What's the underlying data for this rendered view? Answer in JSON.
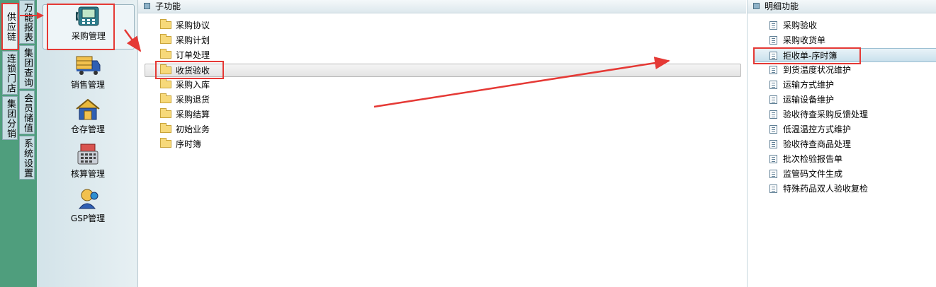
{
  "vertical_tabs": [
    "供应链",
    "连锁门店",
    "集团分销",
    "万能报表",
    "集团查询",
    "会员储值",
    "系统设置"
  ],
  "modules": [
    {
      "label": "采购管理",
      "icon": "purchase-phone-icon"
    },
    {
      "label": "销售管理",
      "icon": "delivery-truck-icon"
    },
    {
      "label": "仓存管理",
      "icon": "warehouse-house-icon"
    },
    {
      "label": "核算管理",
      "icon": "calculator-icon"
    },
    {
      "label": "GSP管理",
      "icon": "gsp-person-icon"
    }
  ],
  "sub_panel": {
    "title": "子功能",
    "items": [
      "采购协议",
      "采购计划",
      "订单处理",
      "收货验收",
      "采购入库",
      "采购退货",
      "采购结算",
      "初始业务",
      "序时簿"
    ],
    "selected": "收货验收"
  },
  "detail_panel": {
    "title": "明细功能",
    "items": [
      "采购验收",
      "采购收货单",
      "拒收单-序时簿",
      "到货温度状况维护",
      "运输方式维护",
      "运输设备维护",
      "验收待查采购反馈处理",
      "低温温控方式维护",
      "验收待查商品处理",
      "批次检验报告单",
      "监管码文件生成",
      "特殊药品双人验收复检"
    ],
    "selected": "拒收单-序时簿"
  },
  "colors": {
    "annotation": "#e53935",
    "strip": "#4f9e7d"
  }
}
